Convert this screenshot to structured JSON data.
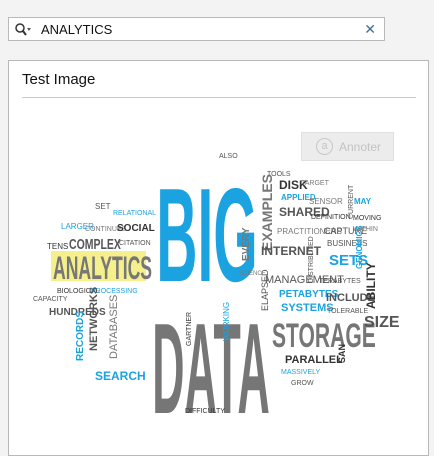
{
  "search": {
    "value": "ANALYTICS",
    "clear_icon": "close-icon",
    "search_icon": "search-icon"
  },
  "panel": {
    "title": "Test Image",
    "annotate_label": "Annoter"
  },
  "colors": {
    "blue": "#1aa3e0",
    "gray": "#767676",
    "dark": "#333333",
    "yellow": "#f5f08c"
  },
  "word_cloud": {
    "main_words": [
      "BIG",
      "DATA",
      "STORAGE",
      "ANALYTICS"
    ],
    "words": [
      "ALSO",
      "TOOLS",
      "DISK",
      "TARGET",
      "APPLIED",
      "SENSOR",
      "MAY",
      "EXAMPLES",
      "SHARED",
      "DEFINITION",
      "CURRENT",
      "MOVING",
      "EVERY",
      "PRACTITIONERS",
      "CAPTURE",
      "WITHIN",
      "SET",
      "RELATIONAL",
      "LARGER",
      "CONTINUES",
      "SOCIAL",
      "TENS",
      "COMPLEX",
      "CITATION",
      "INTERNET",
      "BUSINESS",
      "SETS",
      "GENOMICS",
      "MANAGEMENT",
      "TERABYTES",
      "BIOLOGICAL",
      "PROCESSING",
      "CAPACITY",
      "HUNDREDS",
      "PETABYTES",
      "INCLUDE",
      "ABILITY",
      "SYSTEMS",
      "TOLERABLE",
      "RECORDS",
      "NETWORKS",
      "DATABASES",
      "ELAPSED",
      "SIZE",
      "GARTNER",
      "WORKING",
      "PARALLEL",
      "SAN",
      "SEARCH",
      "MASSIVELY",
      "GROW",
      "DIFFICULTY",
      "DISTRIBUTED",
      "SCIENCE"
    ]
  }
}
